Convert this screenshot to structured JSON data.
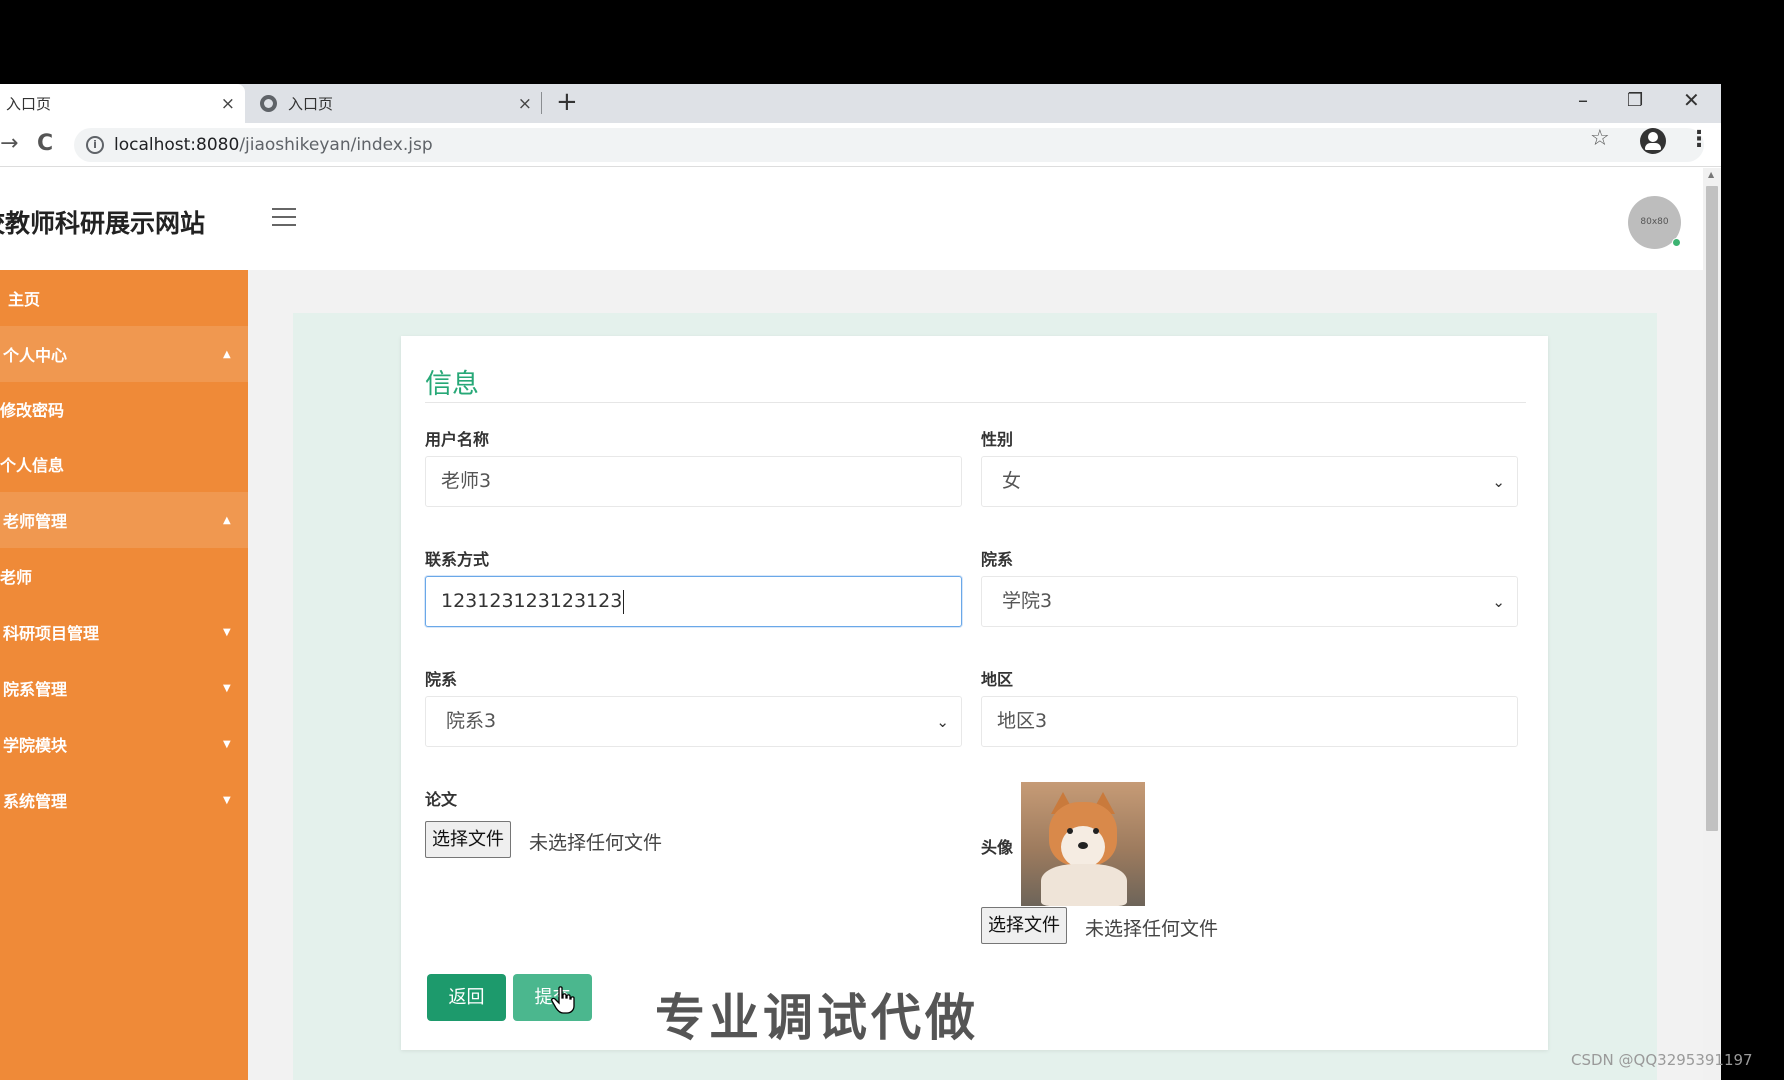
{
  "browser": {
    "tabs": [
      {
        "title": "入口页",
        "close": "×"
      },
      {
        "title": "入口页",
        "close": "×"
      }
    ],
    "new_tab": "+",
    "window_controls": {
      "minimize": "–",
      "restore": "❐",
      "close": "✕"
    },
    "nav": {
      "back": "→",
      "reload": "C"
    },
    "url_host": "localhost:8080",
    "url_path": "/jiaoshikeyan/index.jsp",
    "star": "☆",
    "menu": "⋮"
  },
  "header": {
    "site_title": "校教师科研展示网站",
    "avatar_text": "80x80"
  },
  "sidebar": {
    "items": [
      {
        "label": "主页",
        "caret": ""
      },
      {
        "label": "个人中心",
        "caret": "▲"
      },
      {
        "label": "修改密码",
        "caret": ""
      },
      {
        "label": "个人信息",
        "caret": ""
      },
      {
        "label": "老师管理",
        "caret": "▲"
      },
      {
        "label": "老师",
        "caret": ""
      },
      {
        "label": "科研项目管理",
        "caret": "▼"
      },
      {
        "label": "院系管理",
        "caret": "▼"
      },
      {
        "label": "学院模块",
        "caret": "▼"
      },
      {
        "label": "系统管理",
        "caret": "▼"
      }
    ]
  },
  "form": {
    "title": "信息",
    "username": {
      "label": "用户名称",
      "value": "老师3"
    },
    "gender": {
      "label": "性别",
      "value": "女"
    },
    "contact": {
      "label": "联系方式",
      "value": "123123123123123"
    },
    "college": {
      "label": "院系",
      "value": "学院3"
    },
    "department": {
      "label": "院系",
      "value": "院系3"
    },
    "region": {
      "label": "地区",
      "value": "地区3"
    },
    "paper": {
      "label": "论文",
      "button": "选择文件",
      "status": "未选择任何文件"
    },
    "avatar": {
      "label": "头像",
      "button": "选择文件",
      "status": "未选择任何文件"
    },
    "chevron": "⌄",
    "back_button": "返回",
    "submit_button": "提交"
  },
  "bottom_banner": "专业调试代做",
  "watermark": "CSDN @QQ3295391197",
  "colors": {
    "sidebar": "#ef8a38",
    "accent_green": "#27a877",
    "button_back": "#1d9a6c",
    "button_submit": "#4bb78e",
    "content_bg": "#e4f1ec"
  }
}
